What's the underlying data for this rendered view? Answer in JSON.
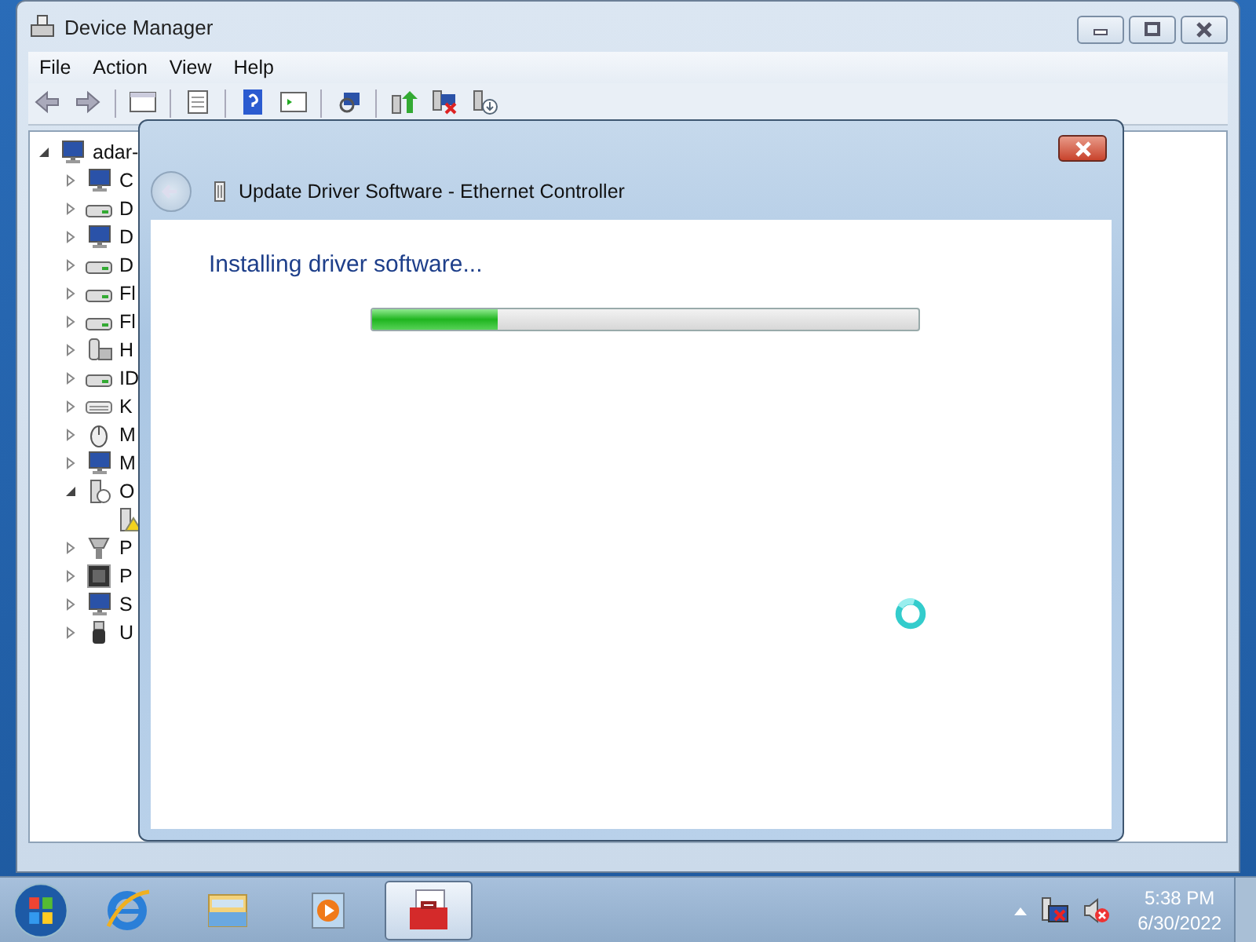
{
  "window": {
    "title": "Device Manager"
  },
  "menu": [
    "File",
    "Action",
    "View",
    "Help"
  ],
  "tree": {
    "label": "adar-",
    "kind": "host",
    "expanded": true,
    "children": [
      {
        "label": "C",
        "kind": "computer",
        "expanded": false
      },
      {
        "label": "D",
        "kind": "drive",
        "expanded": false
      },
      {
        "label": "D",
        "kind": "display",
        "expanded": false
      },
      {
        "label": "D",
        "kind": "dvd",
        "expanded": false
      },
      {
        "label": "Fl",
        "kind": "floppy",
        "expanded": false
      },
      {
        "label": "Fl",
        "kind": "floppy",
        "expanded": false
      },
      {
        "label": "H",
        "kind": "hid",
        "expanded": false
      },
      {
        "label": "ID",
        "kind": "ide",
        "expanded": false
      },
      {
        "label": "K",
        "kind": "keyboard",
        "expanded": false
      },
      {
        "label": "M",
        "kind": "mouse",
        "expanded": false
      },
      {
        "label": "M",
        "kind": "monitor",
        "expanded": false
      },
      {
        "label": "O",
        "kind": "other",
        "expanded": true,
        "children": [
          {
            "kind": "warning"
          }
        ]
      },
      {
        "label": "P",
        "kind": "port",
        "expanded": false
      },
      {
        "label": "P",
        "kind": "processor",
        "expanded": false
      },
      {
        "label": "S",
        "kind": "computer",
        "expanded": false
      },
      {
        "label": "U",
        "kind": "usb",
        "expanded": false
      }
    ]
  },
  "dialog": {
    "title": "Update Driver Software - Ethernet Controller",
    "heading": "Installing driver software...",
    "progress": {
      "level": 0.23
    },
    "busy": true
  },
  "taskbar": {
    "apps": [
      {
        "kind": "browser",
        "selected": false
      },
      {
        "kind": "folder",
        "selected": false
      },
      {
        "kind": "media",
        "selected": false
      },
      {
        "kind": "toolbox",
        "selected": true
      }
    ],
    "tray": {
      "network_connected": false,
      "sound_muted": true
    },
    "clock": {
      "time": "5:38 PM",
      "date": "6/30/2022"
    }
  }
}
